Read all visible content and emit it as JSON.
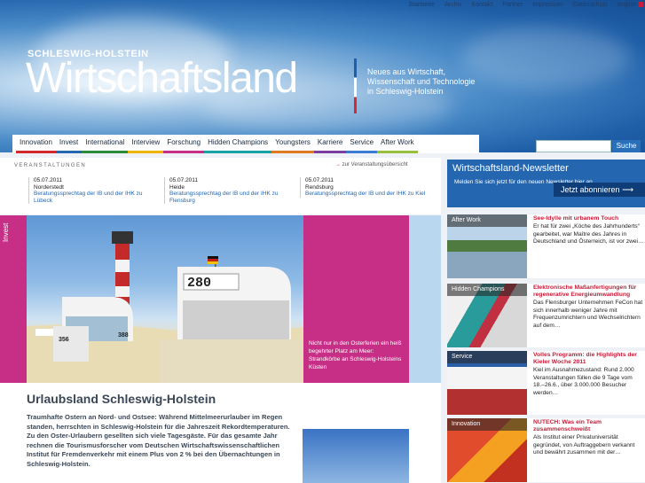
{
  "topnav": {
    "items": [
      "Startseite",
      "Archiv",
      "Kontakt",
      "Partner",
      "Impressum",
      "Datenschutz",
      "english"
    ]
  },
  "brand": {
    "kicker": "SCHLESWIG-HOLSTEIN",
    "title": "Wirtschaftsland",
    "tagline": "Neues aus Wirtschaft,\nWissenschaft und Technologie\nin Schleswig-Holstein"
  },
  "mainnav": [
    {
      "label": "Innovation",
      "color": "#d4282c"
    },
    {
      "label": "Invest",
      "color": "#2466b0"
    },
    {
      "label": "International",
      "color": "#2a8b3a"
    },
    {
      "label": "Interview",
      "color": "#f0b400"
    },
    {
      "label": "Forschung",
      "color": "#c72e86"
    },
    {
      "label": "Hidden Champions",
      "color": "#17a3a3"
    },
    {
      "label": "Youngsters",
      "color": "#e07a1e"
    },
    {
      "label": "Karriere",
      "color": "#7b3fa0"
    },
    {
      "label": "Service",
      "color": "#3a7bd5"
    },
    {
      "label": "After Work",
      "color": "#98c03c"
    }
  ],
  "search": {
    "button": "Suche"
  },
  "events": {
    "label": "VERANSTALTUNGEN",
    "all_link": "zur Veranstaltungsübersicht",
    "items": [
      {
        "date": "05.07.2011",
        "place": "Norderstedt",
        "title": "Beratungssprechtag der IB und der IHK zu Lübeck"
      },
      {
        "date": "05.07.2011",
        "place": "Heide",
        "title": "Beratungssprechtag der IB und der IHK zu Flensburg"
      },
      {
        "date": "05.07.2011",
        "place": "Rendsburg",
        "title": "Beratungssprechtag der IB und der IHK zu Kiel"
      }
    ]
  },
  "teaser": {
    "tag": "Invest",
    "caption": "Nicht nur in den Osterferien ein heiß begehrter Platz am Meer: Strandkörbe an Schleswig-Holsteins Küsten",
    "basket_numbers": [
      "280",
      "356",
      "388"
    ]
  },
  "article": {
    "title": "Urlaubsland Schleswig-Holstein",
    "text": "Traumhafte Ostern an Nord- und Ostsee: Während Mittelmeerurlauber im Regen standen, herrschten in Schleswig-Holstein für die Jahreszeit Rekordtemperaturen. Zu den Oster-Urlaubern gesellten sich viele Tagesgäste. Für das gesamte Jahr rechnen die Tourismusforscher vom Deutschen Wirtschaftswissenschaftlichen Institut für Fremdenverkehr mit einem Plus von 2 % bei den Übernachtungen in Schleswig-Holstein."
  },
  "newsletter": {
    "title": "Wirtschaftsland-Newsletter",
    "text": "Melden Sie sich jetzt für den neuen Newsletter hier an.",
    "button": "Jetzt abonnieren"
  },
  "sidebar": [
    {
      "category": "After Work",
      "title": "See-Idylle mit urbanem Touch",
      "text": "Er hat für zwei „Köche des Jahrhunderts“ gearbeitet, war Maître des Jahres in Deutschland und Österreich, ist vor zwei…"
    },
    {
      "category": "Hidden Champions",
      "title": "Elektronische Maßanfertigungen für regenerative Energieumwandlung",
      "text": "Das Flensburger Unternehmen FeCon hat sich innerhalb weniger Jahre mit Frequenzumrichtern und Wechselrichtern auf dem…"
    },
    {
      "category": "Service",
      "title": "Volles Programm: die Highlights der Kieler Woche 2011",
      "text": "Kiel im Ausnahmezustand: Rund 2.000 Veranstaltungen füllen die 9 Tage vom 18.–26.6., über 3.000.000 Besucher werden…"
    },
    {
      "category": "Innovation",
      "title": "NUTECH: Was ein Team zusammenschweißt",
      "text": "Als Institut einer Privatuniversität gegründet, von Auftraggebern verkannt und bewährt zusammen mit der…"
    }
  ]
}
